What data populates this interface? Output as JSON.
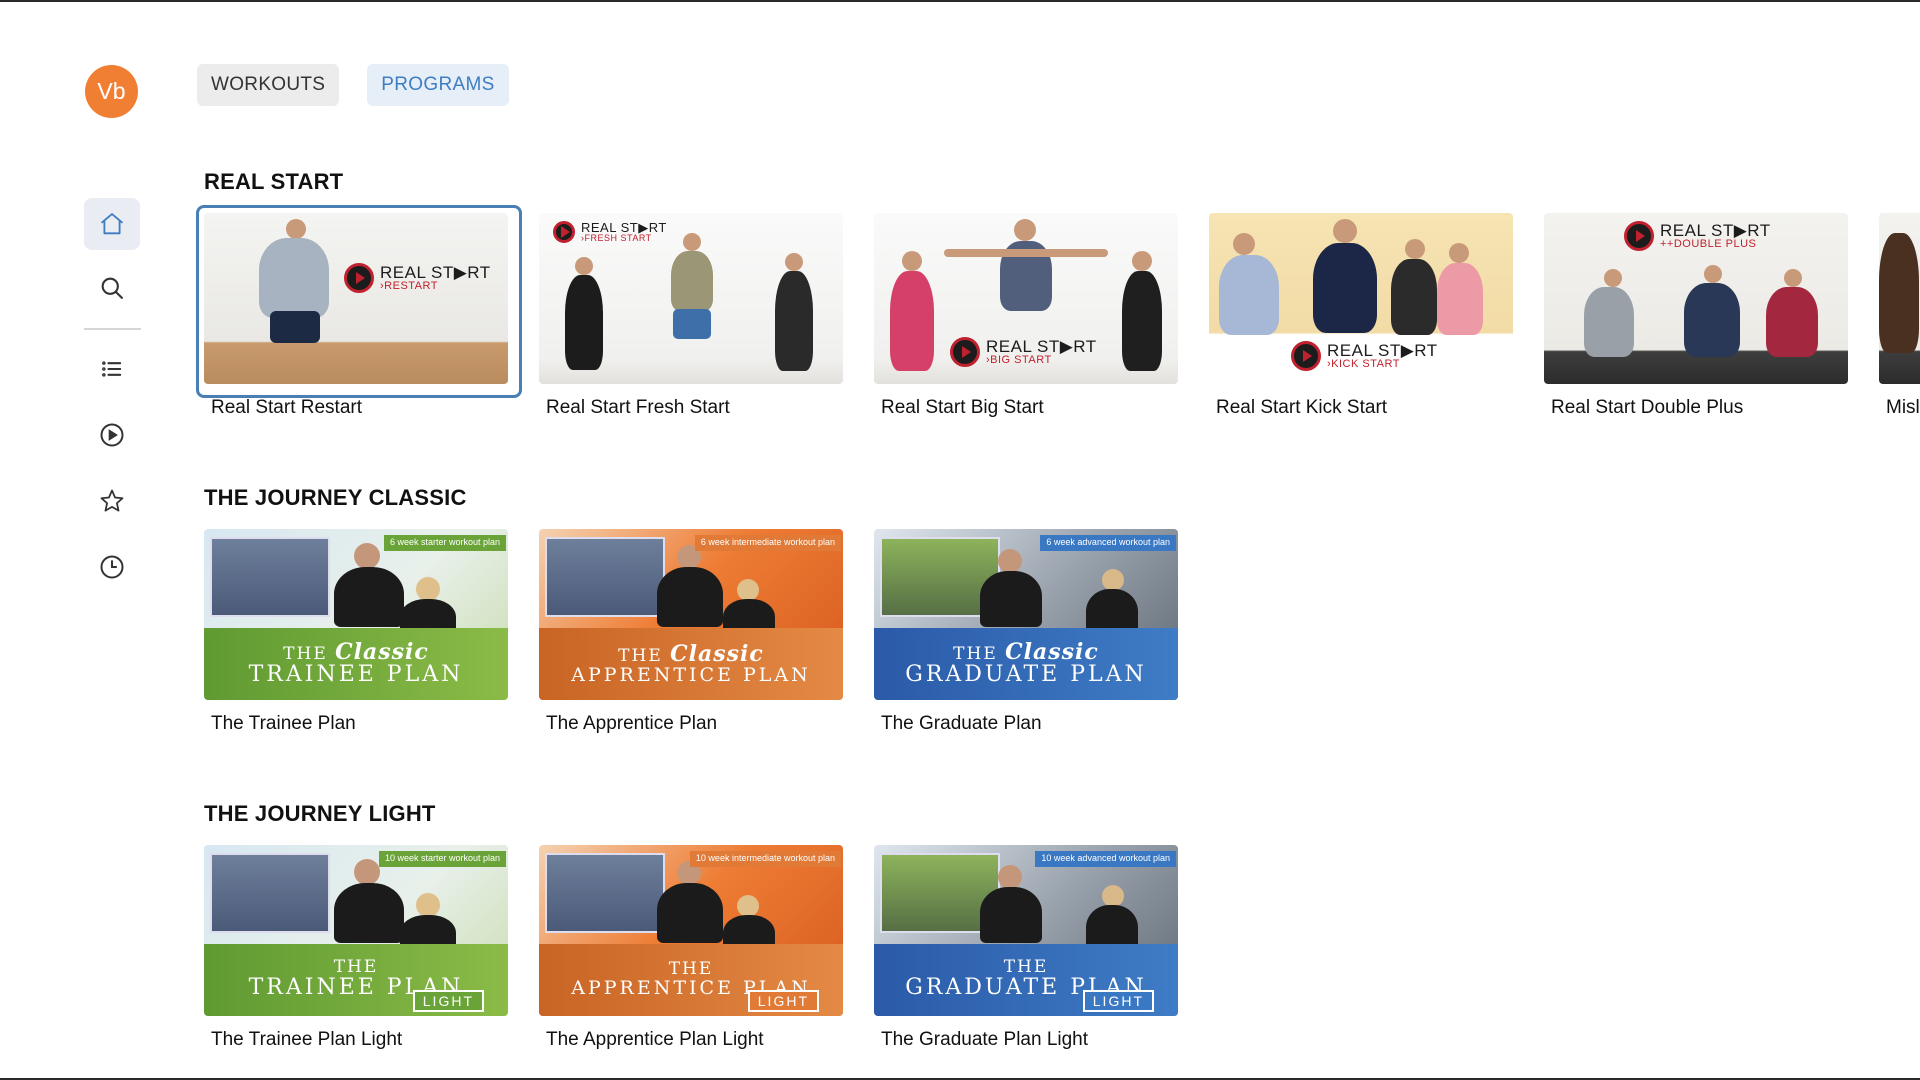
{
  "sidebar": {
    "avatar_initials": "Vb",
    "items": [
      {
        "name": "home",
        "icon": "home-icon",
        "active": true
      },
      {
        "name": "search",
        "icon": "search-icon",
        "active": false
      },
      {
        "name": "list",
        "icon": "list-icon",
        "active": false
      },
      {
        "name": "play",
        "icon": "play-circle-icon",
        "active": false
      },
      {
        "name": "favorites",
        "icon": "star-icon",
        "active": false
      },
      {
        "name": "history",
        "icon": "clock-icon",
        "active": false
      }
    ]
  },
  "tabs": {
    "workouts": "WORKOUTS",
    "programs": "PROGRAMS"
  },
  "colors": {
    "avatar": "#f07f33",
    "programs_tab_text": "#3f7dc2",
    "focus_border": "#4a7fb5",
    "trainee_green": "#6aa338",
    "apprentice_orange": "#d06a2a",
    "graduate_blue": "#2c5aa8",
    "real_start_red": "#c0212f"
  },
  "sections": [
    {
      "title": "REAL START",
      "cards": [
        {
          "title": "Real Start Restart",
          "logo_main": "REAL ST▶RT",
          "logo_sub": "›RESTART"
        },
        {
          "title": "Real Start Fresh Start",
          "logo_main": "REAL ST▶RT",
          "logo_sub": "›FRESH START"
        },
        {
          "title": "Real Start Big Start",
          "logo_main": "REAL ST▶RT",
          "logo_sub": "›BIG START"
        },
        {
          "title": "Real Start Kick Start",
          "logo_main": "REAL ST▶RT",
          "logo_sub": "›KICK START"
        },
        {
          "title": "Real Start Double Plus",
          "logo_main": "REAL ST▶RT",
          "logo_sub": "++DOUBLE PLUS"
        },
        {
          "title": "Misl"
        }
      ]
    },
    {
      "title": "THE JOURNEY CLASSIC",
      "cards": [
        {
          "title": "The Trainee Plan",
          "the": "THE",
          "classic": "Classic",
          "plan": "TRAINEE PLAN",
          "tag": "6 week starter workout plan"
        },
        {
          "title": "The Apprentice Plan",
          "the": "THE",
          "classic": "Classic",
          "plan": "APPRENTICE PLAN",
          "tag": "6 week intermediate workout plan"
        },
        {
          "title": "The Graduate Plan",
          "the": "THE",
          "classic": "Classic",
          "plan": "GRADUATE PLAN",
          "tag": "6 week advanced workout plan"
        }
      ]
    },
    {
      "title": "THE JOURNEY LIGHT",
      "cards": [
        {
          "title": "The Trainee Plan Light",
          "the": "THE",
          "plan": "TRAINEE PLAN",
          "light": "LIGHT",
          "tag": "10 week starter workout plan"
        },
        {
          "title": "The Apprentice Plan Light",
          "the": "THE",
          "plan": "APPRENTICE PLAN",
          "light": "LIGHT",
          "tag": "10 week intermediate workout plan"
        },
        {
          "title": "The Graduate Plan Light",
          "the": "THE",
          "plan": "GRADUATE PLAN",
          "light": "LIGHT",
          "tag": "10 week advanced workout plan"
        }
      ]
    }
  ]
}
